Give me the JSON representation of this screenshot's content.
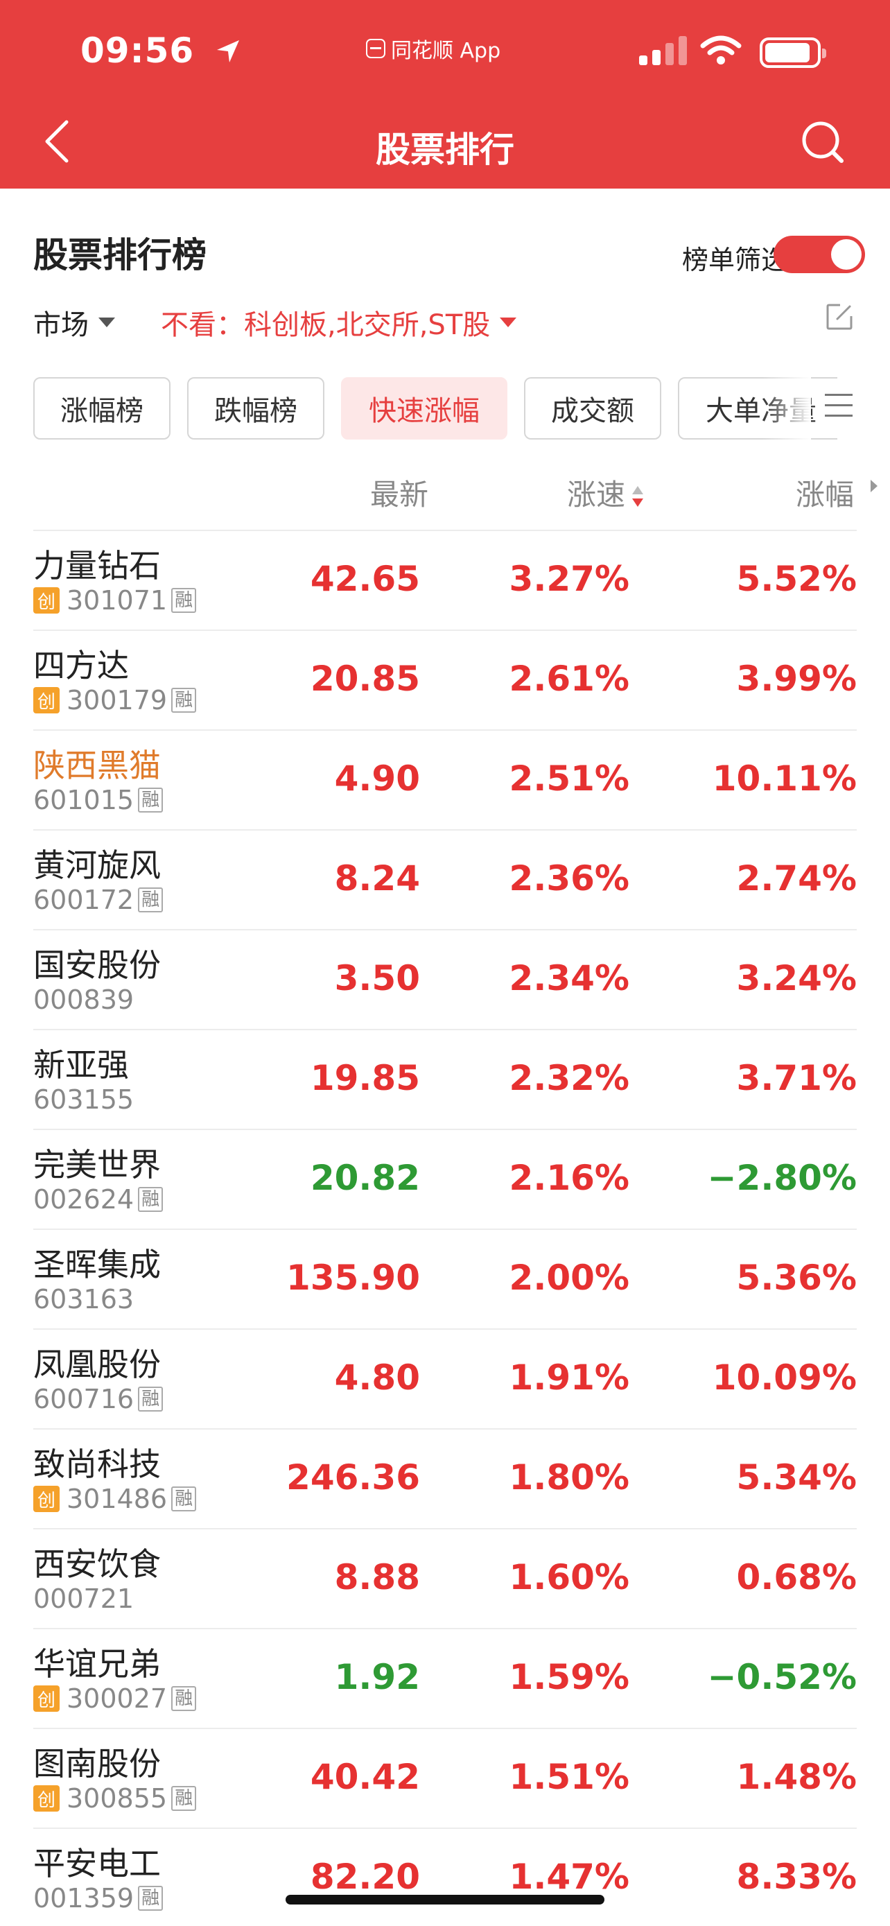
{
  "status_bar": {
    "time": "09:56",
    "app_name": "同花顺 App"
  },
  "nav": {
    "title": "股票排行"
  },
  "section": {
    "title": "股票排行榜",
    "filter_label": "榜单筛选",
    "filter_enabled": true,
    "market_label": "市场",
    "exclude_label": "不看：科创板,北交所,ST股"
  },
  "tabs": [
    {
      "label": "涨幅榜",
      "active": false
    },
    {
      "label": "跌幅榜",
      "active": false
    },
    {
      "label": "快速涨幅",
      "active": true
    },
    {
      "label": "成交额",
      "active": false
    },
    {
      "label": "大单净量",
      "active": false
    }
  ],
  "columns": {
    "latest": "最新",
    "speed": "涨速",
    "change": "涨幅"
  },
  "badges": {
    "chuang": "创",
    "rong": "融"
  },
  "colors": {
    "accent": "#e63f3f",
    "up": "#e63131",
    "down": "#2e9a34",
    "highlight_name": "#e07b2b"
  },
  "rows": [
    {
      "name": "力量钻石",
      "code": "301071",
      "chuang": true,
      "rong": true,
      "price": "42.65",
      "speed": "3.27%",
      "change": "5.52%",
      "price_dir": "up",
      "change_dir": "up"
    },
    {
      "name": "四方达",
      "code": "300179",
      "chuang": true,
      "rong": true,
      "price": "20.85",
      "speed": "2.61%",
      "change": "3.99%",
      "price_dir": "up",
      "change_dir": "up"
    },
    {
      "name": "陕西黑猫",
      "code": "601015",
      "chuang": false,
      "rong": true,
      "price": "4.90",
      "speed": "2.51%",
      "change": "10.11%",
      "price_dir": "up",
      "change_dir": "up",
      "highlight": true
    },
    {
      "name": "黄河旋风",
      "code": "600172",
      "chuang": false,
      "rong": true,
      "price": "8.24",
      "speed": "2.36%",
      "change": "2.74%",
      "price_dir": "up",
      "change_dir": "up"
    },
    {
      "name": "国安股份",
      "code": "000839",
      "chuang": false,
      "rong": false,
      "price": "3.50",
      "speed": "2.34%",
      "change": "3.24%",
      "price_dir": "up",
      "change_dir": "up"
    },
    {
      "name": "新亚强",
      "code": "603155",
      "chuang": false,
      "rong": false,
      "price": "19.85",
      "speed": "2.32%",
      "change": "3.71%",
      "price_dir": "up",
      "change_dir": "up"
    },
    {
      "name": "完美世界",
      "code": "002624",
      "chuang": false,
      "rong": true,
      "price": "20.82",
      "speed": "2.16%",
      "change": "−2.80%",
      "price_dir": "down",
      "change_dir": "down"
    },
    {
      "name": "圣晖集成",
      "code": "603163",
      "chuang": false,
      "rong": false,
      "price": "135.90",
      "speed": "2.00%",
      "change": "5.36%",
      "price_dir": "up",
      "change_dir": "up"
    },
    {
      "name": "凤凰股份",
      "code": "600716",
      "chuang": false,
      "rong": true,
      "price": "4.80",
      "speed": "1.91%",
      "change": "10.09%",
      "price_dir": "up",
      "change_dir": "up"
    },
    {
      "name": "致尚科技",
      "code": "301486",
      "chuang": true,
      "rong": true,
      "price": "246.36",
      "speed": "1.80%",
      "change": "5.34%",
      "price_dir": "up",
      "change_dir": "up"
    },
    {
      "name": "西安饮食",
      "code": "000721",
      "chuang": false,
      "rong": false,
      "price": "8.88",
      "speed": "1.60%",
      "change": "0.68%",
      "price_dir": "up",
      "change_dir": "up"
    },
    {
      "name": "华谊兄弟",
      "code": "300027",
      "chuang": true,
      "rong": true,
      "price": "1.92",
      "speed": "1.59%",
      "change": "−0.52%",
      "price_dir": "down",
      "change_dir": "down"
    },
    {
      "name": "图南股份",
      "code": "300855",
      "chuang": true,
      "rong": true,
      "price": "40.42",
      "speed": "1.51%",
      "change": "1.48%",
      "price_dir": "up",
      "change_dir": "up"
    },
    {
      "name": "平安电工",
      "code": "001359",
      "chuang": false,
      "rong": true,
      "price": "82.20",
      "speed": "1.47%",
      "change": "8.33%",
      "price_dir": "up",
      "change_dir": "up"
    }
  ]
}
